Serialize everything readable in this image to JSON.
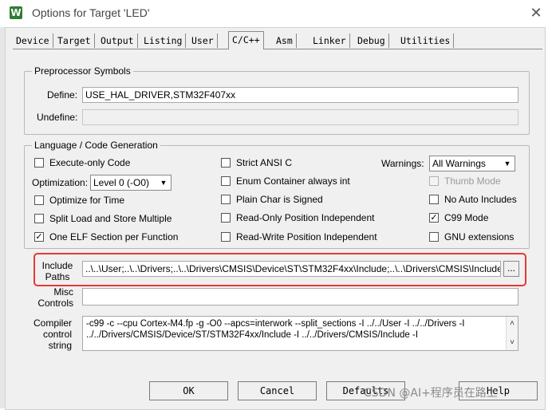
{
  "window": {
    "title": "Options for Target 'LED'",
    "icon_glyph": "W",
    "close_glyph": "✕"
  },
  "tabs": [
    "Device",
    "Target",
    "Output",
    "Listing",
    "User",
    "C/C++",
    "Asm",
    "Linker",
    "Debug",
    "Utilities"
  ],
  "active_tab": "C/C++",
  "preprocessor": {
    "title": "Preprocessor Symbols",
    "define_label": "Define:",
    "define_value": "USE_HAL_DRIVER,STM32F407xx",
    "undefine_label": "Undefine:",
    "undefine_value": ""
  },
  "language": {
    "title": "Language / Code Generation",
    "execute_only": {
      "label": "Execute-only Code",
      "checked": false
    },
    "optimization_label": "Optimization:",
    "optimization_value": "Level 0 (-O0)",
    "optimize_time": {
      "label": "Optimize for Time",
      "checked": false
    },
    "split_load": {
      "label": "Split Load and Store Multiple",
      "checked": false
    },
    "one_elf": {
      "label": "One ELF Section per Function",
      "checked": true
    },
    "strict_ansi": {
      "label": "Strict ANSI C",
      "checked": false
    },
    "enum_container": {
      "label": "Enum Container always int",
      "checked": false
    },
    "plain_char": {
      "label": "Plain Char is Signed",
      "checked": false
    },
    "ropi": {
      "label": "Read-Only Position Independent",
      "checked": false
    },
    "rwpi": {
      "label": "Read-Write Position Independent",
      "checked": false
    },
    "warnings_label": "Warnings:",
    "warnings_value": "All Warnings",
    "thumb_mode": {
      "label": "Thumb Mode",
      "checked": false,
      "disabled": true
    },
    "no_auto_includes": {
      "label": "No Auto Includes",
      "checked": false
    },
    "c99_mode": {
      "label": "C99 Mode",
      "checked": true
    },
    "gnu_extensions": {
      "label": "GNU extensions",
      "checked": false
    }
  },
  "include_paths": {
    "label_line1": "Include",
    "label_line2": "Paths",
    "value": "..\\..\\User;..\\..\\Drivers;..\\..\\Drivers\\CMSIS\\Device\\ST\\STM32F4xx\\Include;..\\..\\Drivers\\CMSIS\\Include",
    "browse_label": "..."
  },
  "misc_controls": {
    "label_line1": "Misc",
    "label_line2": "Controls",
    "value": ""
  },
  "compiler_control": {
    "label_line1": "Compiler",
    "label_line2": "control",
    "label_line3": "string",
    "line1": "-c99 -c --cpu Cortex-M4.fp -g -O0 --apcs=interwork --split_sections -I ../../User -I ../../Drivers -I",
    "line2": "../../Drivers/CMSIS/Device/ST/STM32F4xx/Include -I ../../Drivers/CMSIS/Include -I"
  },
  "buttons": {
    "ok": "OK",
    "cancel": "Cancel",
    "defaults": "Defaults",
    "help": "Help"
  },
  "watermark": "CSDN @AI+程序员在路上",
  "colors": {
    "highlight_box": "#e53935",
    "checked_mark": "#000000",
    "dialog_bg": "#f0f0f0"
  }
}
